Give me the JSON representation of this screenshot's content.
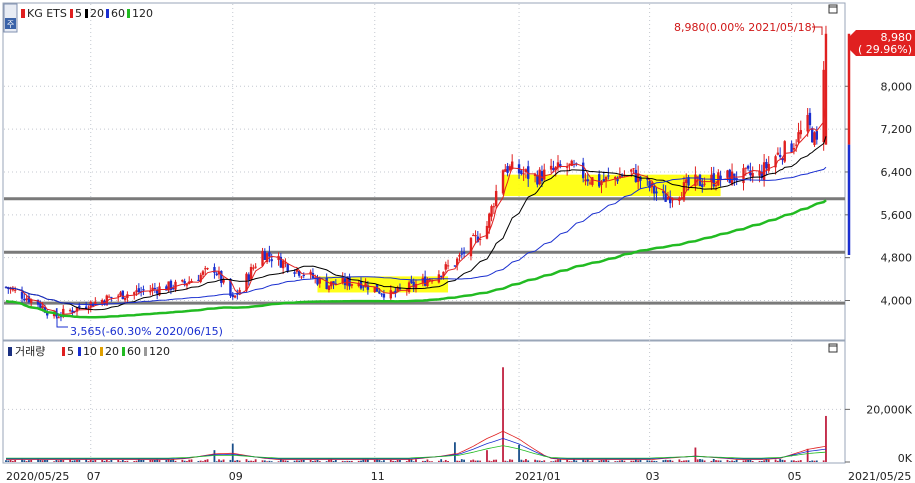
{
  "legend": {
    "symbol": "KG ETS",
    "ma": [
      {
        "label": "5",
        "color": "#e02020"
      },
      {
        "label": "20",
        "color": "#000000"
      },
      {
        "label": "60",
        "color": "#1a2fd0"
      },
      {
        "label": "120",
        "color": "#22bb22"
      }
    ]
  },
  "volume_legend": {
    "label": "거래량",
    "ma": [
      {
        "label": "5",
        "color": "#e02020"
      },
      {
        "label": "10",
        "color": "#1a2fd0"
      },
      {
        "label": "20",
        "color": "#e0a000"
      },
      {
        "label": "60",
        "color": "#22bb22"
      },
      {
        "label": "120",
        "color": "#999999"
      }
    ]
  },
  "annotations": {
    "high": "8,980(0.00% 2021/05/18)",
    "low": "3,565(-60.30% 2020/06/15)"
  },
  "current_price": {
    "price": "8,980",
    "change": "( 29.96%)",
    "color": "#e02020"
  },
  "chart_data": {
    "type": "candlestick",
    "symbol": "KG ETS",
    "x_range": [
      "2020/05/25",
      "2021/05/25"
    ],
    "x_ticks": [
      "2020/05/25",
      "07",
      "09",
      "11",
      "2021/01",
      "03",
      "05",
      "2021/05/25"
    ],
    "y_ticks": [
      "4,000",
      "4,800",
      "5,600",
      "6,400",
      "7,200",
      "8,000"
    ],
    "ylim": [
      3300,
      9200
    ],
    "volume_ticks": [
      "0K",
      "20,000K"
    ],
    "volume_ylim": [
      0,
      38000
    ],
    "horizontal_lines": [
      3950,
      4900,
      5900
    ],
    "highlight_zones": [
      {
        "from": "2020/10/08",
        "to": "2020/12/04",
        "low": 4150,
        "high": 4450
      },
      {
        "from": "2020/12/28",
        "to": "2021/04/02",
        "low": 5950,
        "high": 6350
      }
    ],
    "price_series": [
      {
        "date": "2020/05/25",
        "close": 4250
      },
      {
        "date": "2020/06/08",
        "close": 3950
      },
      {
        "date": "2020/06/15",
        "close": 3700
      },
      {
        "date": "2020/06/29",
        "close": 3920
      },
      {
        "date": "2020/07/13",
        "close": 4100
      },
      {
        "date": "2020/07/27",
        "close": 4200
      },
      {
        "date": "2020/08/10",
        "close": 4300
      },
      {
        "date": "2020/08/24",
        "close": 4600
      },
      {
        "date": "2020/09/01",
        "close": 4000
      },
      {
        "date": "2020/09/14",
        "close": 4900
      },
      {
        "date": "2020/09/28",
        "close": 4600
      },
      {
        "date": "2020/10/12",
        "close": 4300
      },
      {
        "date": "2020/10/26",
        "close": 4350
      },
      {
        "date": "2020/11/09",
        "close": 4100
      },
      {
        "date": "2020/11/23",
        "close": 4350
      },
      {
        "date": "2020/12/07",
        "close": 4700
      },
      {
        "date": "2020/12/21",
        "close": 5400
      },
      {
        "date": "2020/12/28",
        "close": 6500
      },
      {
        "date": "2021/01/11",
        "close": 6300
      },
      {
        "date": "2021/01/25",
        "close": 6500
      },
      {
        "date": "2021/02/08",
        "close": 6200
      },
      {
        "date": "2021/02/22",
        "close": 6400
      },
      {
        "date": "2021/03/08",
        "close": 5900
      },
      {
        "date": "2021/03/22",
        "close": 6200
      },
      {
        "date": "2021/04/05",
        "close": 6300
      },
      {
        "date": "2021/04/19",
        "close": 6350
      },
      {
        "date": "2021/04/26",
        "close": 6700
      },
      {
        "date": "2021/05/03",
        "close": 6900
      },
      {
        "date": "2021/05/10",
        "close": 7300
      },
      {
        "date": "2021/05/14",
        "close": 6910
      },
      {
        "date": "2021/05/18",
        "close": 8980
      }
    ],
    "volume_spikes": [
      {
        "date": "2020/08/24",
        "volume": 4500
      },
      {
        "date": "2020/09/01",
        "volume": 7000
      },
      {
        "date": "2020/12/07",
        "volume": 7500
      },
      {
        "date": "2020/12/21",
        "volume": 4500
      },
      {
        "date": "2020/12/28",
        "volume": 36000
      },
      {
        "date": "2021/01/04",
        "volume": 6500
      },
      {
        "date": "2021/03/22",
        "volume": 5500
      },
      {
        "date": "2021/05/10",
        "volume": 5000
      },
      {
        "date": "2021/05/18",
        "volume": 17500
      }
    ]
  }
}
